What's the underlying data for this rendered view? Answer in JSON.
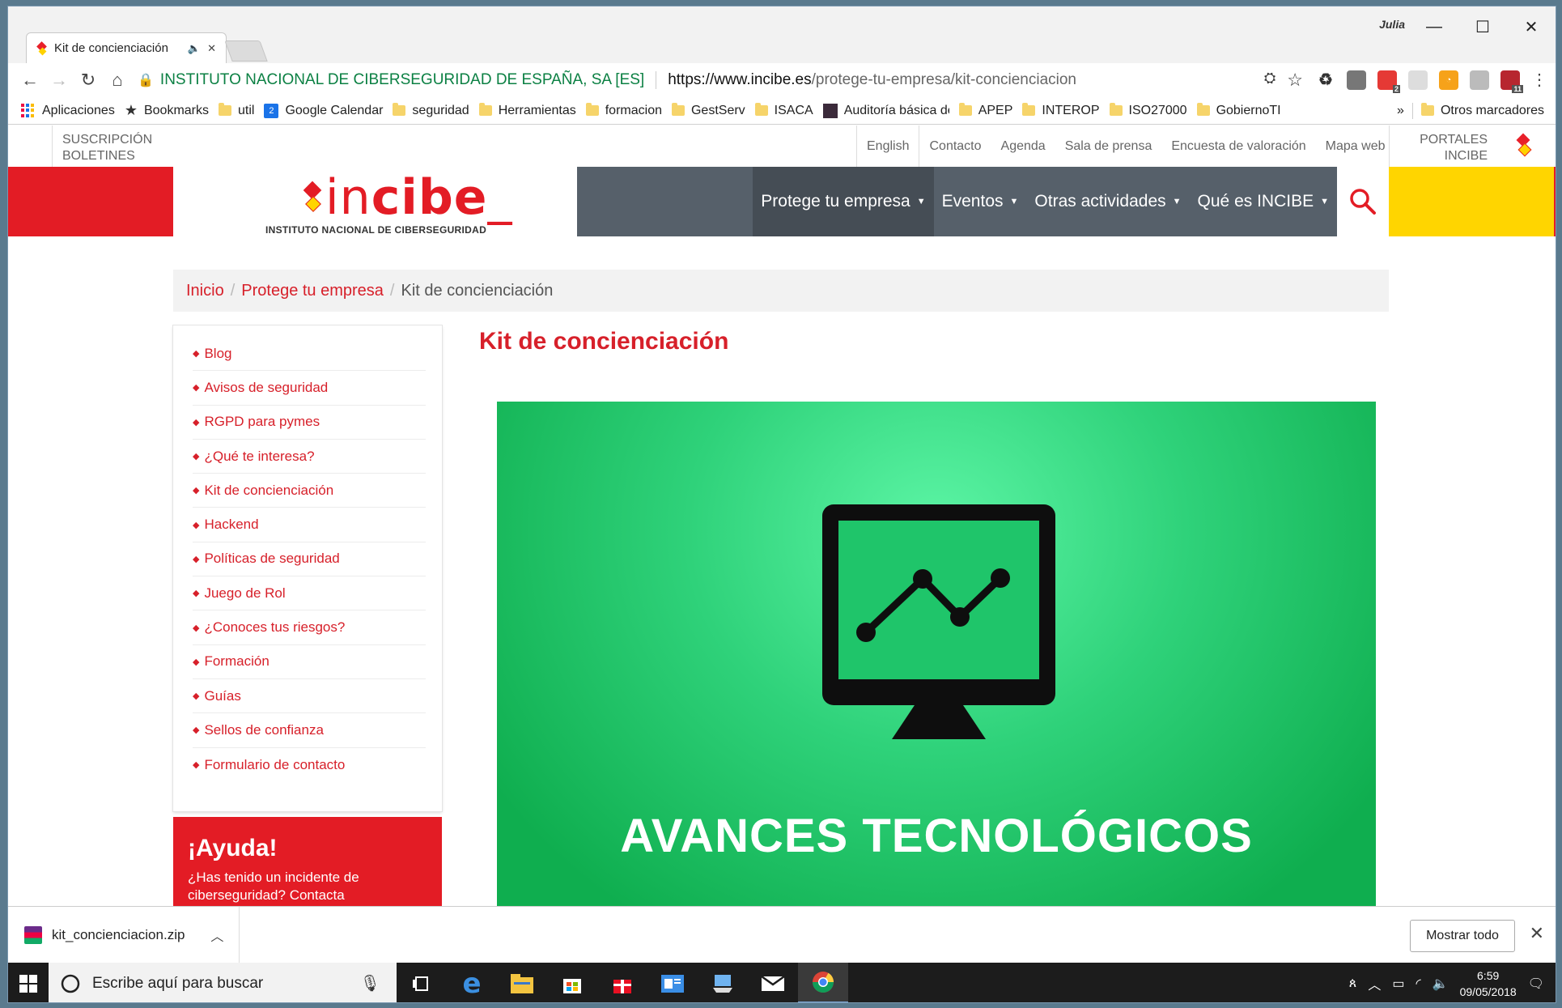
{
  "browser": {
    "tab_title": "Kit de concienciación",
    "user": "Julia",
    "security_org": "INSTITUTO NACIONAL DE CIBERSEGURIDAD DE ESPAÑA, SA [ES]",
    "url_scheme_host": "https://www.incibe.es",
    "url_path": "/protege-tu-empresa/kit-concienciacion",
    "bookmarks": [
      "Aplicaciones",
      "Bookmarks",
      "util",
      "Google Calendar",
      "seguridad",
      "Herramientas",
      "formacion",
      "GestServ",
      "ISACA",
      "Auditoría básica de S",
      "APEP",
      "INTEROP",
      "ISO27000",
      "GobiernoTI"
    ],
    "bookmarks_overflow": "»",
    "other_bookmarks": "Otros marcadores",
    "calendar_day": "2",
    "ext_badges": [
      "2",
      "11"
    ]
  },
  "site": {
    "subscription": [
      "SUSCRIPCIÓN",
      "BOLETINES"
    ],
    "utility_links": [
      "English",
      "Contacto",
      "Agenda",
      "Sala de prensa",
      "Encuesta de valoración",
      "Mapa web"
    ],
    "portales": [
      "PORTALES",
      "INCIBE"
    ],
    "logo_word_pre": "in",
    "logo_word_bold": "cibe",
    "logo_word_post": "_",
    "logo_subtitle": "INSTITUTO NACIONAL DE CIBERSEGURIDAD",
    "nav": [
      "Protege tu empresa",
      "Eventos",
      "Otras actividades",
      "Qué es INCIBE"
    ],
    "breadcrumb": {
      "home": "Inicio",
      "section": "Protege tu empresa",
      "current": "Kit de concienciación",
      "sep": "/"
    },
    "sidebar": [
      "Blog",
      "Avisos de seguridad",
      "RGPD para pymes",
      "¿Qué te interesa?",
      "Kit de concienciación",
      "Hackend",
      "Políticas de seguridad",
      "Juego de Rol",
      "¿Conoces tus riesgos?",
      "Formación",
      "Guías",
      "Sellos de confianza",
      "Formulario de contacto"
    ],
    "help_title": "¡Ayuda!",
    "help_text": "¿Has tenido un incidente de ciberseguridad? Contacta",
    "page_title": "Kit de concienciación",
    "hero_caption": "AVANCES TECNOLÓGICOS"
  },
  "downloads": {
    "file": "kit_concienciacion.zip",
    "show_all": "Mostrar todo"
  },
  "taskbar": {
    "search_placeholder": "Escribe aquí para buscar",
    "time": "6:59",
    "date": "09/05/2018"
  },
  "colors": {
    "brand_red": "#e31c25",
    "brand_yellow": "#ffd500",
    "nav_gray": "#56606a",
    "hero_green": "#2fd27a"
  }
}
